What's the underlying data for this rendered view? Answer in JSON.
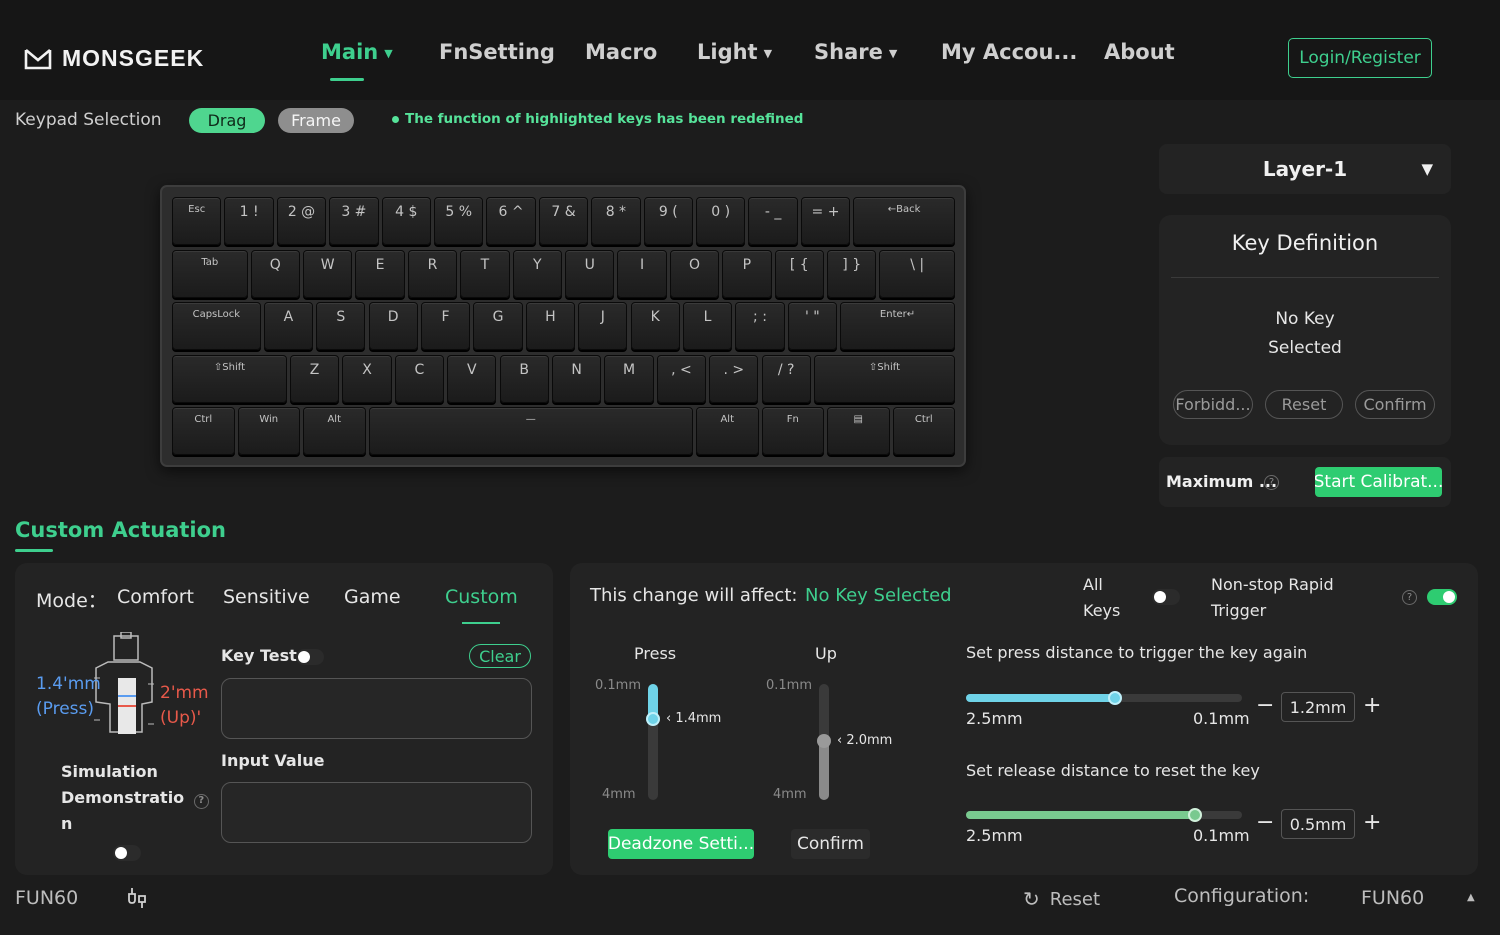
{
  "brand": {
    "name": "MONSGEEK"
  },
  "nav": {
    "items": [
      {
        "label": "Main",
        "caret": true,
        "active": true
      },
      {
        "label": "FnSetting"
      },
      {
        "label": "Macro"
      },
      {
        "label": "Light",
        "caret": true
      },
      {
        "label": "Share",
        "caret": true
      },
      {
        "label": "My Accou..."
      },
      {
        "label": "About"
      }
    ],
    "login": "Login/Register"
  },
  "keypad": {
    "label": "Keypad Selection",
    "drag": "Drag",
    "frame": "Frame",
    "notice": "The function of highlighted keys has been redefined"
  },
  "keyboard": {
    "rows": [
      [
        {
          "t": "Esc",
          "w": 1,
          "s": 1
        },
        {
          "t": "1 !"
        },
        {
          "t": "2 @"
        },
        {
          "t": "3 #"
        },
        {
          "t": "4 $"
        },
        {
          "t": "5 %"
        },
        {
          "t": "6 ^"
        },
        {
          "t": "7 &"
        },
        {
          "t": "8 *"
        },
        {
          "t": "9 ("
        },
        {
          "t": "0 )"
        },
        {
          "t": "- _"
        },
        {
          "t": "= +"
        },
        {
          "t": "←Back",
          "w": 2,
          "s": 1
        }
      ],
      [
        {
          "t": "Tab",
          "w": 1.5,
          "s": 1
        },
        {
          "t": "Q"
        },
        {
          "t": "W"
        },
        {
          "t": "E"
        },
        {
          "t": "R"
        },
        {
          "t": "T"
        },
        {
          "t": "Y"
        },
        {
          "t": "U"
        },
        {
          "t": "I"
        },
        {
          "t": "O"
        },
        {
          "t": "P"
        },
        {
          "t": "[ {"
        },
        {
          "t": "] }"
        },
        {
          "t": "\\ |",
          "w": 1.5
        }
      ],
      [
        {
          "t": "CapsLock",
          "w": 1.75,
          "s": 1
        },
        {
          "t": "A"
        },
        {
          "t": "S"
        },
        {
          "t": "D"
        },
        {
          "t": "F"
        },
        {
          "t": "G"
        },
        {
          "t": "H"
        },
        {
          "t": "J"
        },
        {
          "t": "K"
        },
        {
          "t": "L"
        },
        {
          "t": "; :"
        },
        {
          "t": "' \""
        },
        {
          "t": "Enter↵",
          "w": 2.25,
          "s": 1
        }
      ],
      [
        {
          "t": "⇧Shift",
          "w": 2.25,
          "s": 1
        },
        {
          "t": "Z"
        },
        {
          "t": "X"
        },
        {
          "t": "C"
        },
        {
          "t": "V"
        },
        {
          "t": "B"
        },
        {
          "t": "N"
        },
        {
          "t": "M"
        },
        {
          "t": ", <"
        },
        {
          "t": ". >"
        },
        {
          "t": "/ ?"
        },
        {
          "t": "⇧Shift",
          "w": 2.75,
          "s": 1
        }
      ],
      [
        {
          "t": "Ctrl",
          "w": 1.25,
          "s": 1
        },
        {
          "t": "Win",
          "w": 1.25,
          "s": 1
        },
        {
          "t": "Alt",
          "w": 1.25,
          "s": 1
        },
        {
          "t": "—",
          "w": 6.25,
          "s": 1
        },
        {
          "t": "Alt",
          "w": 1.25,
          "s": 1
        },
        {
          "t": "Fn",
          "w": 1.25,
          "s": 1
        },
        {
          "t": "▤",
          "w": 1.25,
          "s": 1
        },
        {
          "t": "Ctrl",
          "w": 1.25,
          "s": 1
        }
      ]
    ]
  },
  "right_panel": {
    "layer": "Layer-1",
    "key_def_title": "Key Definition",
    "no_key_line1": "No Key",
    "no_key_line2": "Selected",
    "forbid": "Forbidd...",
    "reset": "Reset",
    "confirm": "Confirm",
    "maximum": "Maximum ...",
    "start_calib": "Start Calibrat..."
  },
  "custom_actuation": {
    "title": "Custom Actuation",
    "mode_label": "Mode：",
    "modes": [
      "Comfort",
      "Sensitive",
      "Game",
      "Custom"
    ],
    "active_mode": "Custom",
    "press_val": "1.4'mm",
    "press_lbl": "(Press)",
    "up_val": "2'mm",
    "up_lbl": "(Up)'",
    "sim_line1": "Simulation",
    "sim_line2": "Demonstratio",
    "sim_line3": "n",
    "key_test": "Key Test",
    "clear": "Clear",
    "input_value": "Input Value"
  },
  "affect_panel": {
    "affect_label": "This change will affect:",
    "affect_value": "No Key Selected",
    "all_keys_1": "All",
    "all_keys_2": "Keys",
    "nonstop_1": "Non-stop Rapid",
    "nonstop_2": "Trigger",
    "press_title": "Press",
    "up_title": "Up",
    "press_top": "0.1mm",
    "press_bottom": "4mm",
    "press_value": "1.4mm",
    "press_fraction": 0.3,
    "up_top": "0.1mm",
    "up_bottom": "4mm",
    "up_value": "2.0mm",
    "up_fraction": 0.49,
    "deadzone": "Deadzone Setti...",
    "confirm": "Confirm",
    "rt_press_title": "Set press distance to trigger the key again",
    "rt_press_min": "2.5mm",
    "rt_press_max": "0.1mm",
    "rt_press_value": "1.2mm",
    "rt_press_fraction": 0.54,
    "rt_release_title": "Set release distance to reset the key",
    "rt_release_min": "2.5mm",
    "rt_release_max": "0.1mm",
    "rt_release_value": "0.5mm",
    "rt_release_fraction": 0.83,
    "minus": "−",
    "plus": "+"
  },
  "footer": {
    "device": "FUN60",
    "reset": "Reset",
    "config_label": "Configuration:",
    "config_value": "FUN60"
  },
  "colors": {
    "accent": "#3ecf8e",
    "button_green": "#2ecc71",
    "red": "#e8594a",
    "blue": "#5a9cf0"
  }
}
